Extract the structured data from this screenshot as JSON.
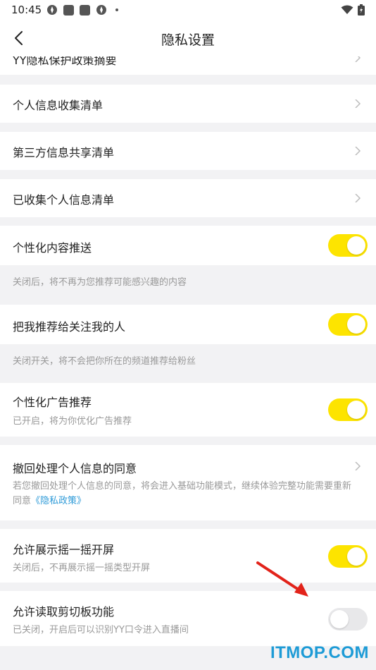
{
  "status_bar": {
    "time": "10:45"
  },
  "nav": {
    "title": "隐私设置"
  },
  "rows": {
    "top_partial": "YY隐私保护政策摘要",
    "collect_list": "个人信息收集清单",
    "third_party": "第三方信息共享清单",
    "collected": "已收集个人信息清单",
    "personalized_content": {
      "title": "个性化内容推送",
      "note": "关闭后，将不再为您推荐可能感兴趣的内容"
    },
    "recommend_to_followers": {
      "title": "把我推荐给关注我的人",
      "note": "关闭开关，将不会把你所在的频道推荐给粉丝"
    },
    "personalized_ads": {
      "title": "个性化广告推荐",
      "sub": "已开启，将为你优化广告推荐"
    },
    "revoke_consent": {
      "title": "撤回处理个人信息的同意",
      "sub_line1": "若您撤回处理个人信息的同意，将会进入基础功能模式，继续体验完整功能需要重新",
      "sub_line2_prefix": "同意",
      "sub_link": "《隐私政策》"
    },
    "shake_screen": {
      "title": "允许展示摇一摇开屏",
      "sub": "关闭后，不再展示摇一摇类型开屏"
    },
    "clipboard": {
      "title": "允许读取剪切板功能",
      "sub": "已关闭，开启后可以识别YY口令进入直播间"
    }
  },
  "toggles": {
    "personalized_content": true,
    "recommend_to_followers": true,
    "personalized_ads": true,
    "shake_screen": true,
    "clipboard": false
  },
  "colors": {
    "toggle_on": "#fde400",
    "toggle_off": "#e8e8ea",
    "link": "#2f9bd8",
    "annotation_arrow": "#e2231a"
  },
  "watermark": "ITMOP.COM"
}
